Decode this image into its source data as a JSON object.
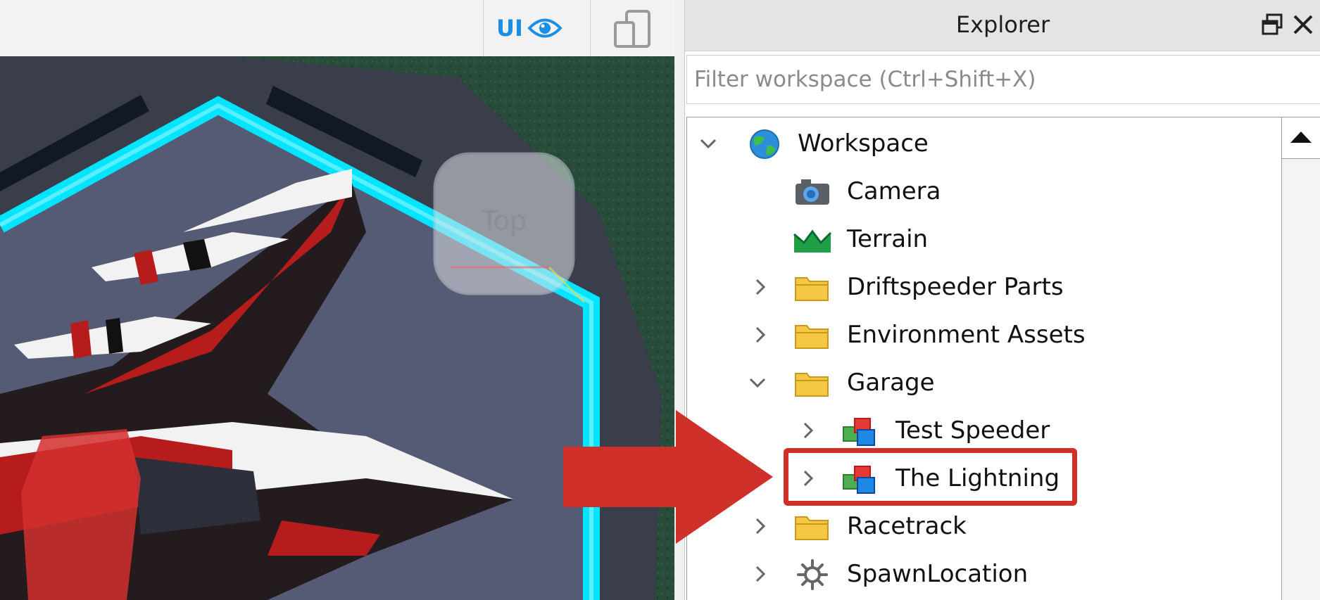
{
  "toolbar": {
    "ui_toggle_label": "UI",
    "ui_toggle_icon": "eye-icon",
    "device_icon": "device-emulator-icon"
  },
  "viewport": {
    "view_cube_label": "Top"
  },
  "explorer": {
    "title": "Explorer",
    "dock_icon": "dock-window-icon",
    "close_icon": "close-icon",
    "filter_placeholder": "Filter workspace (Ctrl+Shift+X)",
    "filter_value": "",
    "tree": [
      {
        "label": "Workspace",
        "icon": "workspace-globe-icon",
        "expanded": true
      },
      {
        "label": "Camera",
        "icon": "camera-icon"
      },
      {
        "label": "Terrain",
        "icon": "terrain-icon"
      },
      {
        "label": "Driftspeeder Parts",
        "icon": "folder-icon",
        "expanded": false
      },
      {
        "label": "Environment Assets",
        "icon": "folder-icon",
        "expanded": false
      },
      {
        "label": "Garage",
        "icon": "folder-icon",
        "expanded": true
      },
      {
        "label": "Test Speeder",
        "icon": "model-icon",
        "expanded": false
      },
      {
        "label": "The Lightning",
        "icon": "model-icon",
        "expanded": false,
        "highlighted": true
      },
      {
        "label": "Racetrack",
        "icon": "folder-icon",
        "expanded": false
      },
      {
        "label": "SpawnLocation",
        "icon": "spawn-location-icon",
        "expanded": false
      }
    ]
  },
  "colors": {
    "accent": "#1a8fe3",
    "highlight": "#d0302a",
    "folder": "#f6c744",
    "neon": "#00e5ff"
  }
}
